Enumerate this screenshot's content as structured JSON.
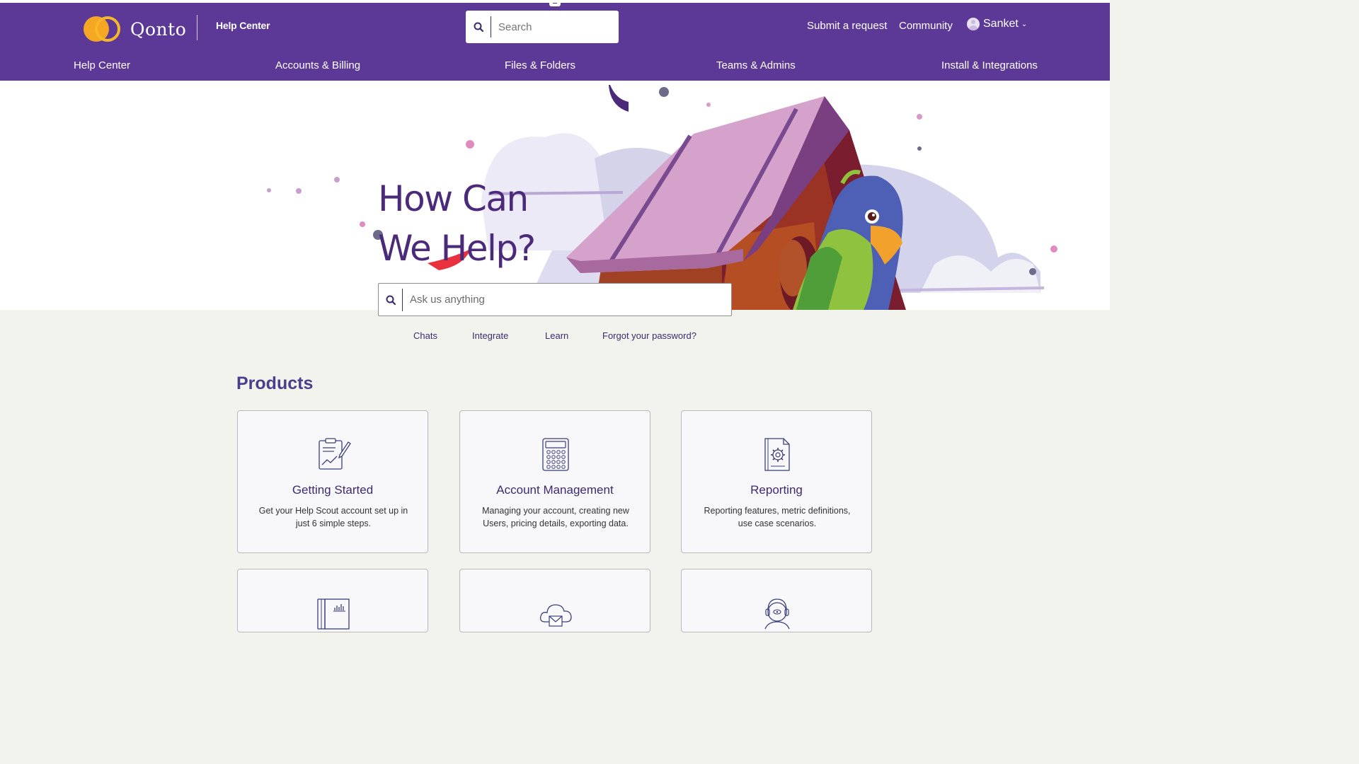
{
  "header": {
    "brand": "Qonto",
    "help_center_label": "Help Center",
    "search_placeholder": "Search",
    "submit_request": "Submit a request",
    "community": "Community",
    "user_name": "Sanket"
  },
  "nav": [
    "Help Center",
    "Accounts & Billing",
    "Files & Folders",
    "Teams & Admins",
    "Install & Integrations"
  ],
  "hero": {
    "title_line1": "How Can",
    "title_line2": "We Help?",
    "ask_placeholder": "Ask us anything"
  },
  "quick_links": [
    "Chats",
    "Integrate",
    "Learn",
    "Forgot your password?"
  ],
  "products": {
    "heading": "Products",
    "cards": [
      {
        "title": "Getting Started",
        "description": "Get your Help Scout account set up in just 6 simple steps.",
        "icon": "clipboard-chart-icon"
      },
      {
        "title": "Account Management",
        "description": "Managing your account, creating new Users, pricing details, exporting data.",
        "icon": "calculator-icon"
      },
      {
        "title": "Reporting",
        "description": "Reporting features, metric definitions, use case scenarios.",
        "icon": "document-gear-icon"
      },
      {
        "title": "",
        "description": "",
        "icon": "book-chart-icon"
      },
      {
        "title": "",
        "description": "",
        "icon": "cloud-mail-icon"
      },
      {
        "title": "",
        "description": "",
        "icon": "support-agent-icon"
      }
    ]
  },
  "colors": {
    "header_bg": "#5c3997",
    "accent": "#4b2a7a",
    "page_bg": "#f3f3ee",
    "logo": "#f5a623"
  }
}
